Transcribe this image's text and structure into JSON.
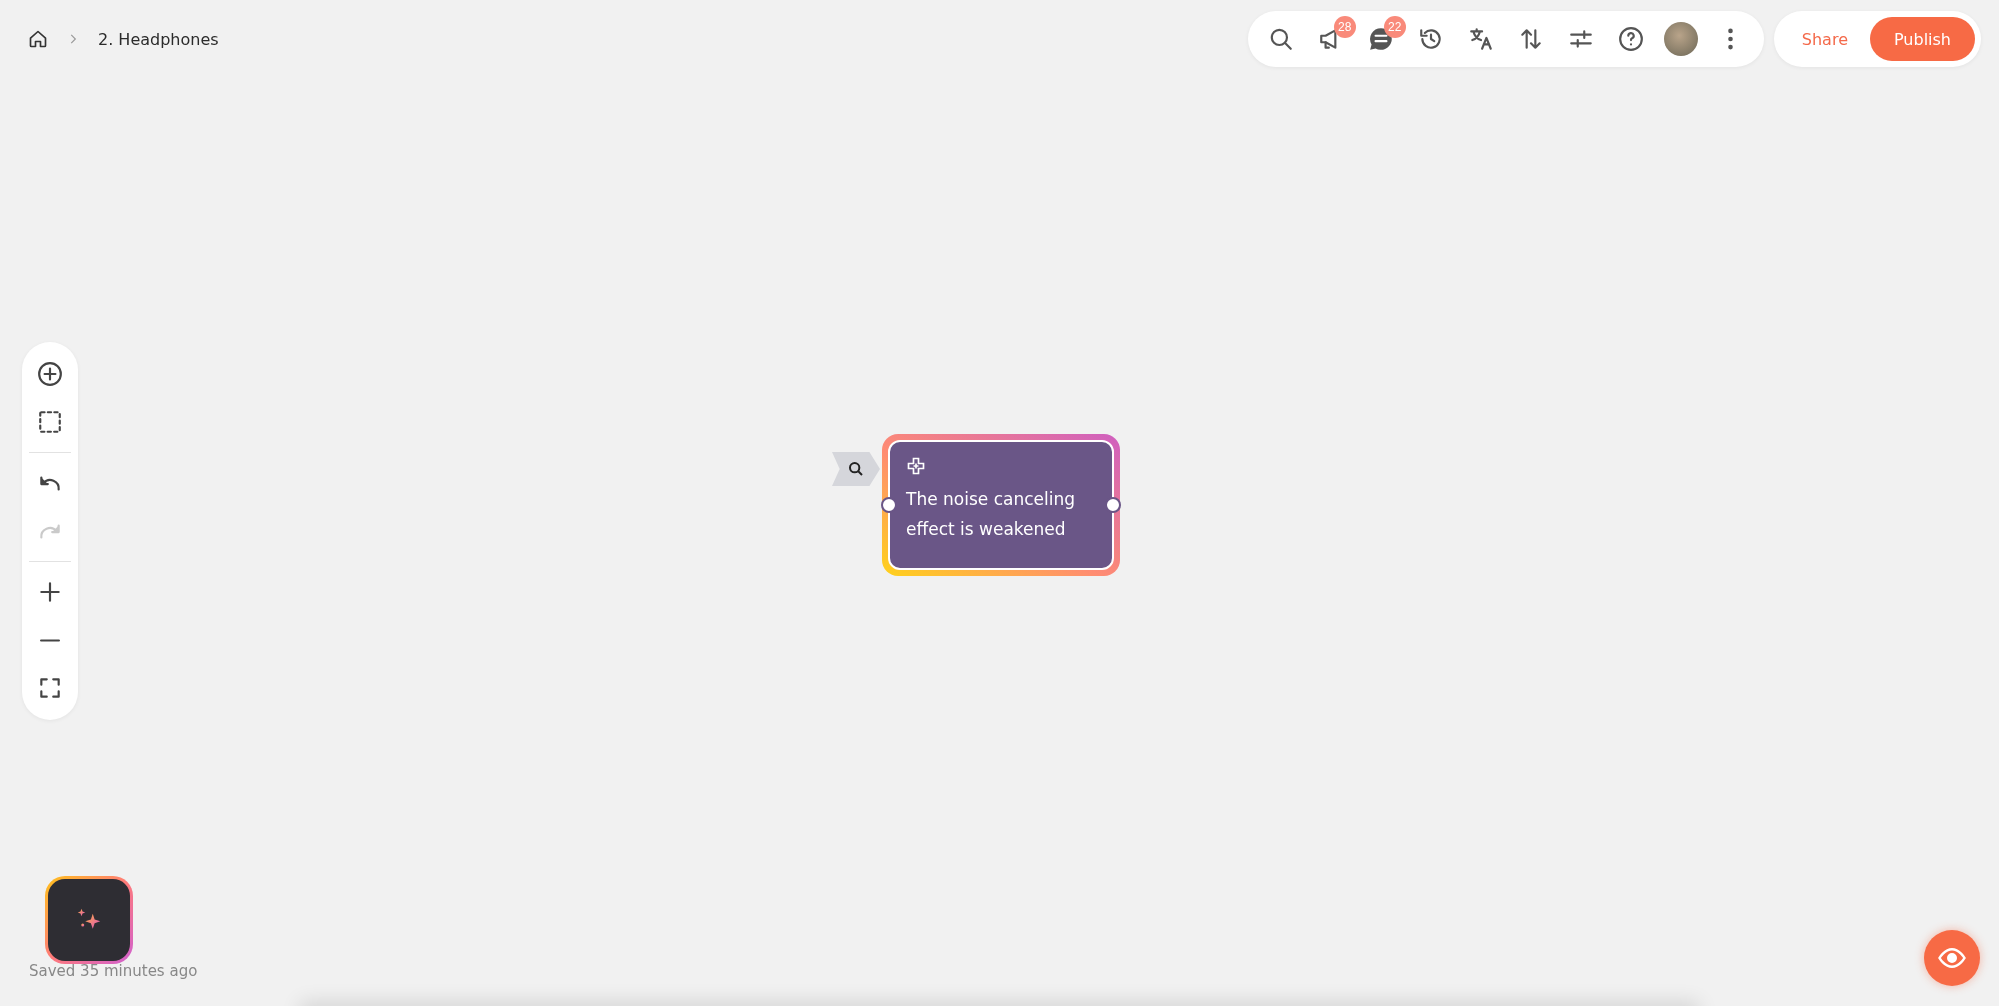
{
  "breadcrumb": {
    "items": [
      "2. Headphones"
    ]
  },
  "toolbar": {
    "tools": [
      {
        "kind": "search"
      },
      {
        "kind": "megaphone",
        "badge": "28"
      },
      {
        "kind": "comments",
        "badge": "22"
      },
      {
        "kind": "history"
      },
      {
        "kind": "translate"
      },
      {
        "kind": "sort"
      },
      {
        "kind": "sliders"
      },
      {
        "kind": "help"
      },
      {
        "kind": "avatar"
      },
      {
        "kind": "more"
      }
    ]
  },
  "actions": {
    "share": "Share",
    "publish": "Publish"
  },
  "side_toolbar": {
    "groups": [
      [
        {
          "kind": "add",
          "disabled": false
        },
        {
          "kind": "select",
          "disabled": false
        }
      ],
      [
        {
          "kind": "undo",
          "disabled": false
        },
        {
          "kind": "redo",
          "disabled": true
        }
      ],
      [
        {
          "kind": "zoom-in",
          "disabled": false
        },
        {
          "kind": "zoom-out",
          "disabled": false
        },
        {
          "kind": "fit",
          "disabled": false
        }
      ]
    ]
  },
  "node": {
    "text": "The noise canceling effect is weakened",
    "selected": true
  },
  "status": {
    "saved": "Saved 35 minutes ago"
  }
}
